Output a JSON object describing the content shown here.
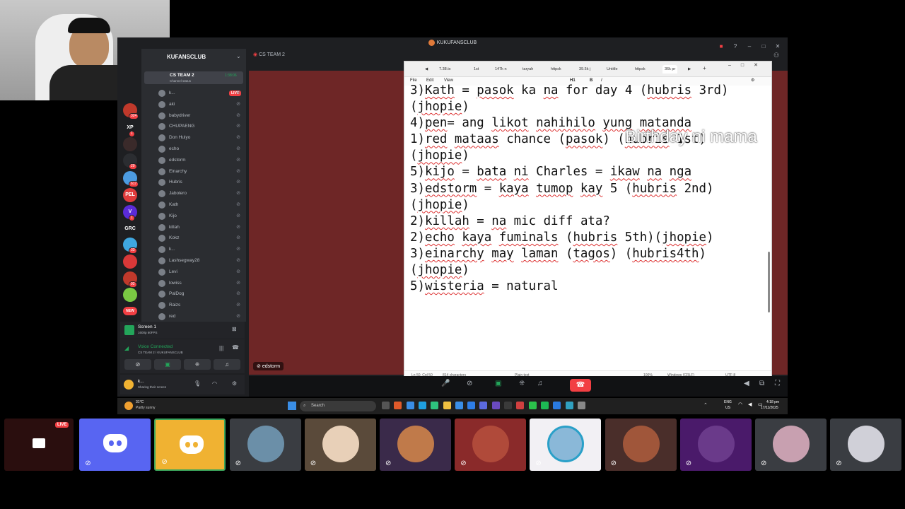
{
  "app": {
    "title": "KUKUFANSCLUB",
    "server_name": "KUFANSCLUB"
  },
  "servers": [
    {
      "label": "",
      "badge": "324",
      "color": "#c0392b"
    },
    {
      "label": "XP",
      "badge": "1",
      "color": "#1e1f22"
    },
    {
      "label": "",
      "badge": "",
      "color": "#3a2a2a"
    },
    {
      "label": "",
      "badge": "29",
      "color": "#2b2d31"
    },
    {
      "label": "",
      "badge": "617",
      "color": "#4c9be0"
    },
    {
      "label": "PEL",
      "badge": "",
      "color": "#e03c3c"
    },
    {
      "label": "V",
      "badge": "1",
      "color": "#5b2bd8"
    },
    {
      "label": "GRC",
      "badge": "",
      "color": "#1e1f22"
    },
    {
      "label": "",
      "badge": "33",
      "color": "#3fa7e0"
    },
    {
      "label": "",
      "badge": "",
      "color": "#d93838"
    },
    {
      "label": "",
      "badge": "92",
      "color": "#c0392b"
    },
    {
      "label": "",
      "badge": "",
      "color": "#7ac943"
    },
    {
      "label": "NEW",
      "badge": "",
      "color": "#f23f43"
    }
  ],
  "voice_channel": {
    "name": "CS TEAM 2",
    "status": "Channel status",
    "timer": "1:38:06",
    "live": "LIVE"
  },
  "members": [
    "k...",
    "aki",
    "babydriver",
    "CHUPAENG",
    "Don Hulyo",
    "echo",
    "edstorm",
    "Einarchy",
    "Hubris",
    "Jabolero",
    "Kath",
    "Kijo",
    "killah",
    "Kokz",
    "k...",
    "Lashsegway28",
    "Levi",
    "lowiss",
    "PalDog",
    "Raizs",
    "red"
  ],
  "member_tags": {
    "don_hulyo": "AOKI",
    "kath": "KATH"
  },
  "screen_panel": {
    "title": "Screen 1",
    "sub": "1600p 60FPS"
  },
  "voice_panel": {
    "status": "Voice Connected",
    "location": "CS TEAM 2 / KUKUFANSCLUB"
  },
  "user_panel": {
    "name": "k...",
    "status": "Sharing their screen"
  },
  "stage": {
    "channel_label": "CS TEAM 2",
    "nameplate": "edstorm"
  },
  "notepad": {
    "tabs": [
      "7.38.tx",
      "1st",
      "147k n",
      "taryah",
      "httpsk",
      "39.5k j",
      "Untitle",
      "httpsk",
      "36k pr"
    ],
    "menu": [
      "File",
      "Edit",
      "View"
    ],
    "status_pos": "Ln 50, Col 50",
    "status_chars": "814 characters",
    "status_type": "Plain text",
    "status_zoom": "100%",
    "status_eol": "Windows (CRLF)",
    "status_enc": "UTF-8"
  },
  "notepad_lines": [
    "3)Kath = pasok ka na for day 4 (hubris 3rd)",
    "(jhopie)",
    "4)pen= ang likot nahihilo yung matanda",
    "1)red mataas chance (pasok) (hubris 1st)",
    "(jhopie)",
    "5)kijo = bata ni Charles = ikaw na nga",
    "3)edstorm = kaya tumop kay 5 (hubris 2nd)",
    "(jhopie)",
    "2)killah = na mic diff ata?",
    "2)echo kaya fuminals (hubris 5th)(jhopie)",
    "3)einarchy may laman (tagos) (hubris4th)",
    "(jhopie)",
    "5)wisteria = natural"
  ],
  "overlay_text": "Birthday ni mama",
  "taskbar": {
    "weather_temp": "31°C",
    "weather_desc": "Partly sunny",
    "search": "Search",
    "lang": "ENG",
    "region": "US",
    "time": "4:18 pm",
    "date": "17/11/2025"
  },
  "tiles": [
    {
      "kind": "screen",
      "bg": "#2a0e0e",
      "label": "LIVE"
    },
    {
      "kind": "discord",
      "bg": "#5865f2"
    },
    {
      "kind": "discord",
      "bg": "#f0b232"
    },
    {
      "kind": "avatar",
      "bg": "#3a3d42",
      "av": "#6b8fa8"
    },
    {
      "kind": "avatar",
      "bg": "#5a4a3a",
      "av": "#e8d0b8"
    },
    {
      "kind": "avatar",
      "bg": "#3a2a4a",
      "av": "#c07a4a"
    },
    {
      "kind": "avatar",
      "bg": "#8a2a2a",
      "av": "#b04a3a"
    },
    {
      "kind": "avatar",
      "bg": "#f2f0f4",
      "av": "#8ab8d8"
    },
    {
      "kind": "avatar",
      "bg": "#4a2e2a",
      "av": "#a0563a"
    },
    {
      "kind": "avatar",
      "bg": "#4a1a6a",
      "av": "#6a3a8a"
    },
    {
      "kind": "avatar",
      "bg": "#3a3d42",
      "av": "#c8a0b0"
    },
    {
      "kind": "avatar",
      "bg": "#3a3d42",
      "av": "#d0d0d8"
    }
  ]
}
